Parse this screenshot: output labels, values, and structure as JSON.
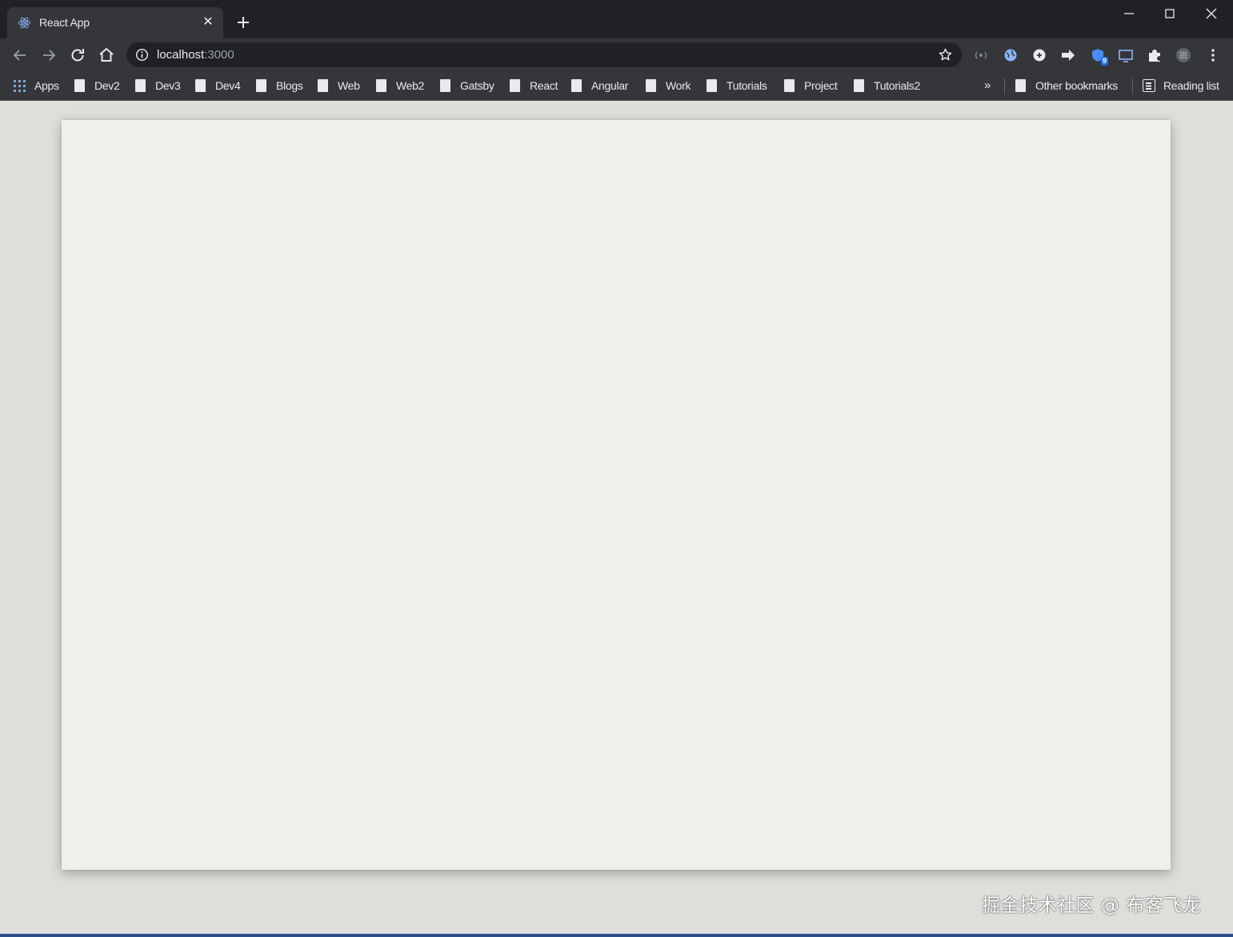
{
  "tab": {
    "title": "React App",
    "close_glyph": "✕"
  },
  "address_bar": {
    "host": "localhost",
    "port": ":3000"
  },
  "extensions": [
    {
      "icon": "broadcast-icon"
    },
    {
      "icon": "world-extension-icon"
    },
    {
      "icon": "circle-extension-icon"
    },
    {
      "icon": "arrow-extension-icon"
    },
    {
      "icon": "shield-extension-icon",
      "badge": "9"
    },
    {
      "icon": "screen-extension-icon"
    },
    {
      "icon": "puzzle-icon"
    },
    {
      "icon": "profile-avatar-icon"
    },
    {
      "icon": "menu-dots-icon"
    }
  ],
  "bookmarks": {
    "apps": "Apps",
    "items": [
      "Dev2",
      "Dev3",
      "Dev4",
      "Blogs",
      "Web",
      "Web2",
      "Gatsby",
      "React",
      "Angular",
      "Work",
      "Tutorials",
      "Project",
      "Tutorials2"
    ],
    "overflow": "»",
    "other": "Other bookmarks",
    "reading_list": "Reading list"
  },
  "watermark": "掘金技术社区 @ 布客飞龙",
  "colors": {
    "titlebar": "#202124",
    "toolbar": "#35363a",
    "page_background": "#dedfdb",
    "card": "#efefec"
  }
}
